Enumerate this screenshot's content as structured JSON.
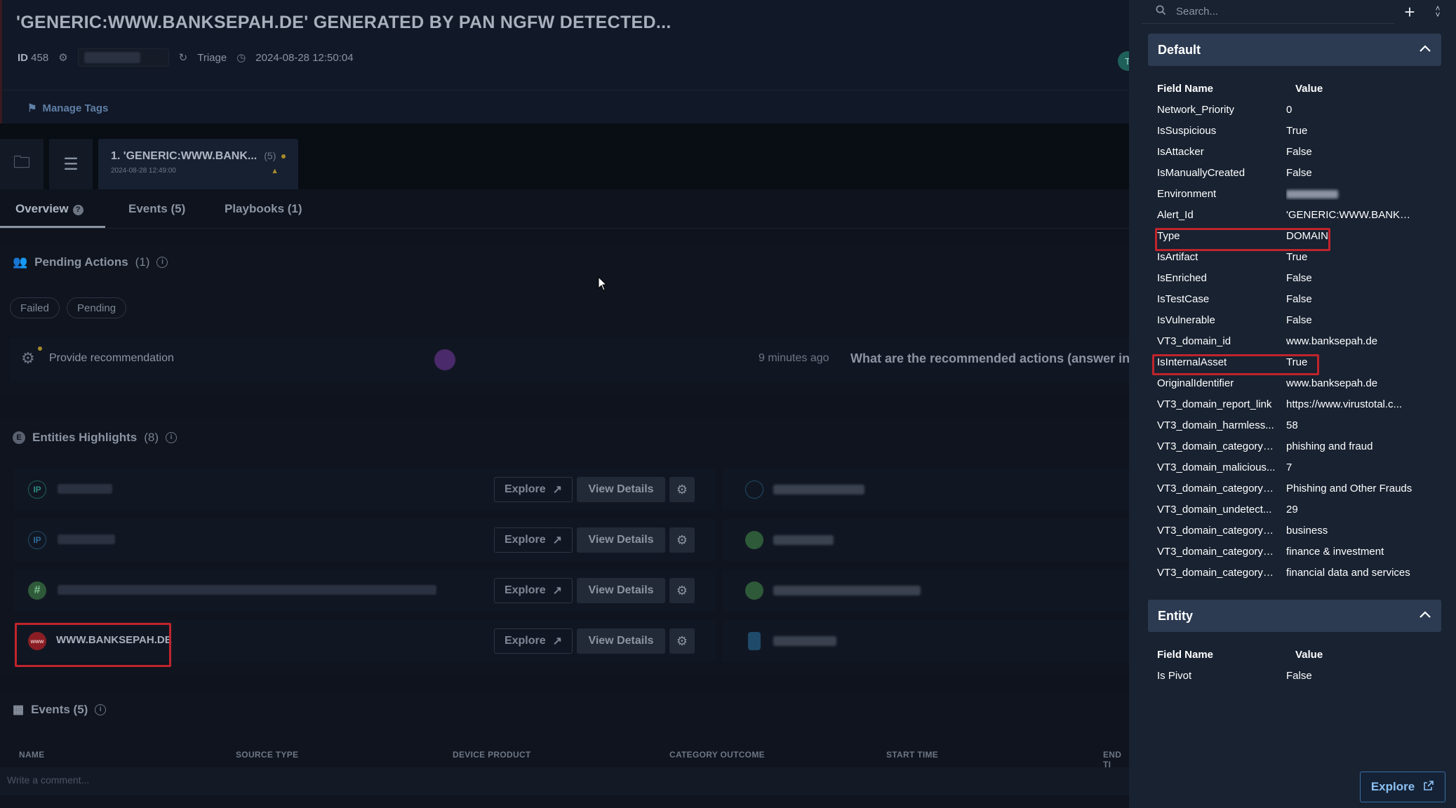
{
  "case": {
    "title": "'GENERIC:WWW.BANKSEPAH.DE' GENERATED BY PAN NGFW DETECTED...",
    "id_label": "ID",
    "id_value": "458",
    "stage": "Triage",
    "timestamp": "2024-08-28 12:50:04",
    "avatar_letter": "T",
    "manage_tags": "Manage Tags"
  },
  "alert_card": {
    "title": "1. 'GENERIC:WWW.BANK...",
    "count": "(5)",
    "date": "2024-08-28 12:49:00"
  },
  "tabs": [
    {
      "label": "Overview",
      "help": "?"
    },
    {
      "label": "Events (5)"
    },
    {
      "label": "Playbooks (1)"
    }
  ],
  "pending": {
    "title": "Pending Actions",
    "count": "(1)",
    "chips": [
      "Failed",
      "Pending"
    ],
    "action_label": "Provide recommendation",
    "ago": "9 minutes ago",
    "question": "What are the recommended actions (answer in engl"
  },
  "entities": {
    "title": "Entities Highlights",
    "count": "(8)",
    "explore_label": "Explore",
    "view_label": "View Details",
    "rows": [
      {
        "icon": "IP",
        "name": ""
      },
      {
        "icon": "IP",
        "name": ""
      },
      {
        "icon": "#",
        "name": ""
      },
      {
        "icon": "www",
        "name": "WWW.BANKSEPAH.DE"
      }
    ]
  },
  "events": {
    "title": "Events (5)",
    "columns": [
      "NAME",
      "SOURCE TYPE",
      "DEVICE PRODUCT",
      "CATEGORY OUTCOME",
      "START TIME",
      "END TI"
    ],
    "comment_placeholder": "Write a comment..."
  },
  "panel": {
    "search_placeholder": "Search...",
    "default_section": {
      "title": "Default",
      "col_field": "Field Name",
      "col_value": "Value",
      "rows": [
        {
          "field": "Network_Priority",
          "value": "0"
        },
        {
          "field": "IsSuspicious",
          "value": "True"
        },
        {
          "field": "IsAttacker",
          "value": "False"
        },
        {
          "field": "IsManuallyCreated",
          "value": "False"
        },
        {
          "field": "Environment",
          "value": ""
        },
        {
          "field": "Alert_Id",
          "value": "'GENERIC:WWW.BANKSE..."
        },
        {
          "field": "Type",
          "value": "DOMAIN"
        },
        {
          "field": "IsArtifact",
          "value": "True"
        },
        {
          "field": "IsEnriched",
          "value": "False"
        },
        {
          "field": "IsTestCase",
          "value": "False"
        },
        {
          "field": "IsVulnerable",
          "value": "False"
        },
        {
          "field": "VT3_domain_id",
          "value": "www.banksepah.de"
        },
        {
          "field": "IsInternalAsset",
          "value": "True"
        },
        {
          "field": "OriginalIdentifier",
          "value": "www.banksepah.de"
        },
        {
          "field": "VT3_domain_report_link",
          "value": "https://www.virustotal.c..."
        },
        {
          "field": "VT3_domain_harmless...",
          "value": "58"
        },
        {
          "field": "VT3_domain_category_...",
          "value": "phishing and fraud"
        },
        {
          "field": "VT3_domain_malicious...",
          "value": "7"
        },
        {
          "field": "VT3_domain_category_...",
          "value": "Phishing and Other Frauds"
        },
        {
          "field": "VT3_domain_undetect...",
          "value": "29"
        },
        {
          "field": "VT3_domain_category_...",
          "value": "business"
        },
        {
          "field": "VT3_domain_category_...",
          "value": "finance & investment"
        },
        {
          "field": "VT3_domain_category_...",
          "value": "financial data and services"
        }
      ]
    },
    "entity_section": {
      "title": "Entity",
      "col_field": "Field Name",
      "col_value": "Value",
      "rows": [
        {
          "field": "Is Pivot",
          "value": "False"
        }
      ]
    },
    "explore_label": "Explore"
  },
  "colors": {
    "highlight": "#c0242c",
    "panel_bg": "#182231",
    "accordion_bg": "#2c3b52",
    "link_blue": "#8cc0f2"
  }
}
